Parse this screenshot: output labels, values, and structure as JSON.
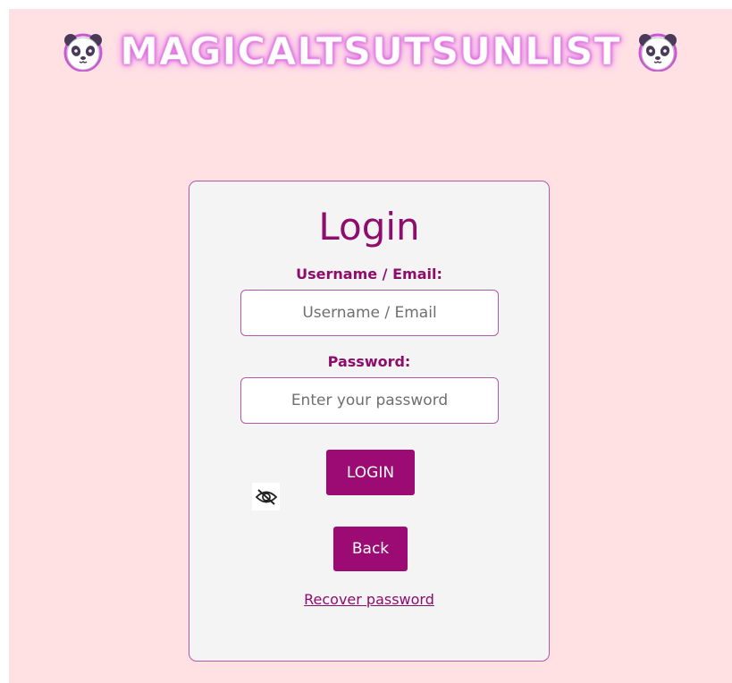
{
  "header": {
    "title": "MAGICALTSUTSUNLIST",
    "left_icon": "panda-face-icon",
    "right_icon": "panda-face-icon"
  },
  "login": {
    "title": "Login",
    "username_label": "Username / Email:",
    "username_placeholder": "Username / Email",
    "password_label": "Password:",
    "password_placeholder": "Enter your password",
    "toggle_icon": "eye-slash-icon",
    "login_button": "LOGIN",
    "back_button": "Back",
    "recover_link": "Recover password"
  },
  "colors": {
    "page_background": "#ffe1e3",
    "card_background": "#f4f4f4",
    "accent": "#9c0b73",
    "text_accent": "#8e0d6c",
    "border": "#b357a8"
  }
}
